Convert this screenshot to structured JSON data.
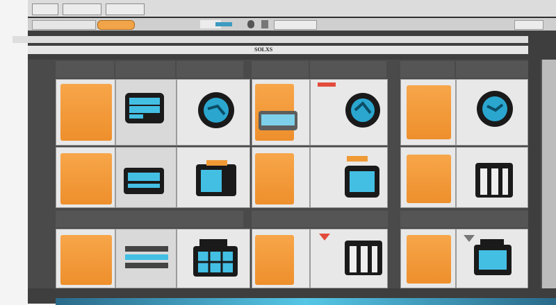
{
  "tabs": [
    "",
    "",
    ""
  ],
  "toolbar": {
    "left_pill": "",
    "orange_pill": "",
    "mid_items": [
      "",
      ""
    ],
    "right_items": [
      "",
      ""
    ]
  },
  "path": "",
  "subbar": {
    "left": "",
    "right": "SOLXS"
  },
  "columns": [
    {
      "header": ""
    },
    {
      "header": ""
    },
    {
      "header": ""
    }
  ],
  "section_headers": [
    "",
    "",
    ""
  ],
  "colors": {
    "accent": "#f09a36",
    "cyan": "#44bfe4",
    "frame": "#3e3e3e",
    "cell": "#e8e8e8"
  }
}
